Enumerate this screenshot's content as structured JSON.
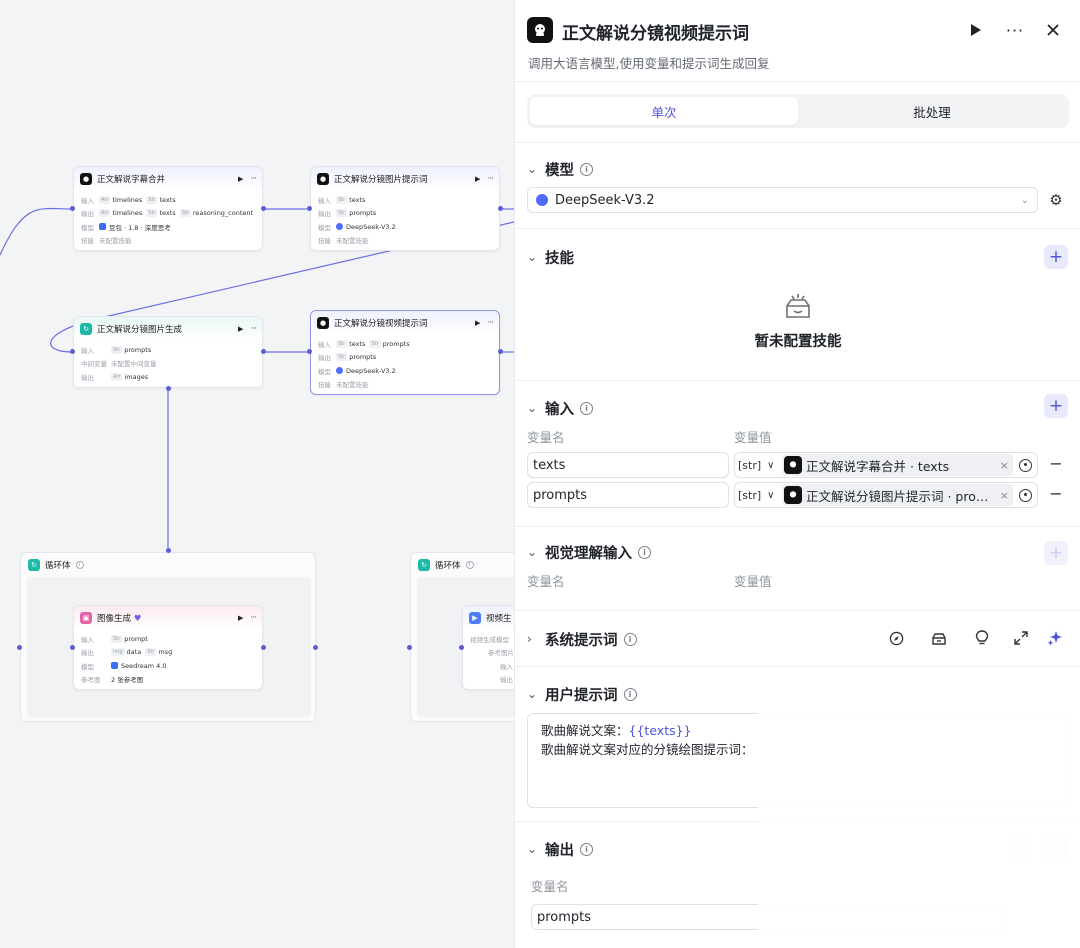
{
  "canvas": {
    "nodes": {
      "subtitle_merge": {
        "title": "正文解说字幕合并",
        "rows": [
          {
            "key": "输入",
            "tags": [
              {
                "t": "Arr",
                "v": "timelines"
              },
              {
                "t": "Str",
                "v": "texts"
              }
            ]
          },
          {
            "key": "输出",
            "tags": [
              {
                "t": "Arr",
                "v": "timelines"
              },
              {
                "t": "Str",
                "v": "texts"
              },
              {
                "t": "Str",
                "v": "reasoning_content"
              }
            ]
          },
          {
            "key": "模型",
            "value": "豆包 · 1.8 · 深度思考"
          },
          {
            "key": "技能",
            "value": "未配置技能"
          }
        ]
      },
      "image_prompt": {
        "title": "正文解说分镜图片提示词",
        "rows": [
          {
            "key": "输入",
            "tags": [
              {
                "t": "Str",
                "v": "texts"
              }
            ]
          },
          {
            "key": "输出",
            "tags": [
              {
                "t": "Str",
                "v": "prompts"
              }
            ]
          },
          {
            "key": "模型",
            "value": "DeepSeek-V3.2"
          },
          {
            "key": "技能",
            "value": "未配置技能"
          }
        ]
      },
      "image_gen_batch": {
        "title": "正文解说分镜图片生成",
        "rows": [
          {
            "key": "输入",
            "tags": [
              {
                "t": "Str",
                "v": "prompts"
              }
            ]
          },
          {
            "key": "中间变量",
            "value": "未配置中间变量"
          },
          {
            "key": "输出",
            "tags": [
              {
                "t": "Arr",
                "v": "images"
              }
            ]
          }
        ]
      },
      "video_prompt": {
        "title": "正文解说分镜视频提示词",
        "rows": [
          {
            "key": "输入",
            "tags": [
              {
                "t": "Str",
                "v": "texts"
              },
              {
                "t": "Str",
                "v": "prompts"
              }
            ]
          },
          {
            "key": "输出",
            "tags": [
              {
                "t": "Str",
                "v": "prompts"
              }
            ]
          },
          {
            "key": "模型",
            "value": "DeepSeek-V3.2"
          },
          {
            "key": "技能",
            "value": "未配置技能"
          }
        ]
      },
      "loop1": {
        "title": "循环体"
      },
      "loop2": {
        "title": "循环体"
      },
      "image_gen": {
        "title": "图像生成",
        "rows": [
          {
            "key": "输入",
            "tags": [
              {
                "t": "Str",
                "v": "prompt"
              }
            ]
          },
          {
            "key": "输出",
            "tags": [
              {
                "t": "Img",
                "v": "data"
              },
              {
                "t": "Str",
                "v": "msg"
              }
            ]
          },
          {
            "key": "模型",
            "value": "Seedream 4.0"
          },
          {
            "key": "参考图",
            "value": "2 张参考图"
          }
        ]
      },
      "video_gen": {
        "title": "视频生",
        "rows": [
          {
            "key": "视频生成模型",
            "value": ""
          },
          {
            "key": "参考图片",
            "value": ""
          },
          {
            "key": "输入",
            "value": ""
          },
          {
            "key": "输出",
            "value": ""
          }
        ]
      }
    }
  },
  "panel": {
    "title": "正文解说分镜视频提示词",
    "subtitle": "调用大语言模型,使用变量和提示词生成回复",
    "tabs": [
      "单次",
      "批处理"
    ],
    "model_section": {
      "label": "模型",
      "selected": "DeepSeek-V3.2"
    },
    "skills_section": {
      "label": "技能",
      "empty_text": "暂未配置技能"
    },
    "input_section": {
      "label": "输入",
      "col_name": "变量名",
      "col_value": "变量值",
      "rows": [
        {
          "name": "texts",
          "type": "[str]",
          "ref": "正文解说字幕合并 · texts"
        },
        {
          "name": "prompts",
          "type": "[str]",
          "ref": "正文解说分镜图片提示词 · pro…"
        }
      ]
    },
    "vision_section": {
      "label": "视觉理解输入",
      "col_name": "变量名",
      "col_value": "变量值"
    },
    "system_prompt_section": {
      "label": "系统提示词"
    },
    "user_prompt_section": {
      "label": "用户提示词",
      "line1_prefix": "歌曲解说文案：",
      "line1_var": "{{texts}}",
      "line2": "歌曲解说文案对应的分镜绘图提示词："
    },
    "output_section": {
      "label": "输出",
      "col_name": "变量名",
      "var_name": "prompts"
    }
  },
  "colors": {
    "accent": "#4b55d8",
    "edge": "#6b6fe6"
  }
}
